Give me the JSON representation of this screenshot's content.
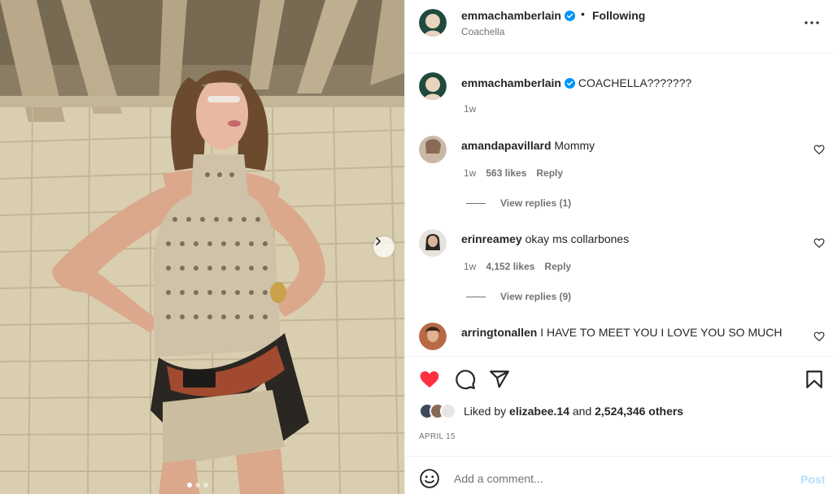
{
  "post": {
    "username": "emmachamberlain",
    "verified": true,
    "separator": "•",
    "follow_status": "Following",
    "location": "Coachella",
    "more_icon": "more-horizontal-icon",
    "carousel": {
      "current": 1,
      "total": 3
    }
  },
  "caption": {
    "username": "emmachamberlain",
    "text": "COACHELLA???????",
    "time": "1w"
  },
  "comments": [
    {
      "username": "amandapavillard",
      "text": "Mommy",
      "time": "1w",
      "likes": "563 likes",
      "reply": "Reply",
      "view_replies": "View replies (1)"
    },
    {
      "username": "erinreamey",
      "text": "okay ms collarbones",
      "time": "1w",
      "likes": "4,152 likes",
      "reply": "Reply",
      "view_replies": "View replies (9)"
    },
    {
      "username": "arringtonallen",
      "text": "I HAVE TO MEET YOU I LOVE YOU SO MUCH"
    }
  ],
  "actions": {
    "liked": true,
    "like_color": "#ff3040"
  },
  "likes": {
    "prefix": "Liked by",
    "user": "elizabee.14",
    "and": "and",
    "count": "2,524,346 others"
  },
  "date": "APRIL 15",
  "comment_box": {
    "placeholder": "Add a comment...",
    "post_label": "Post"
  },
  "colors": {
    "verified": "#0095f6",
    "post_disabled": "#b2dffc",
    "secondary_text": "#737373"
  }
}
